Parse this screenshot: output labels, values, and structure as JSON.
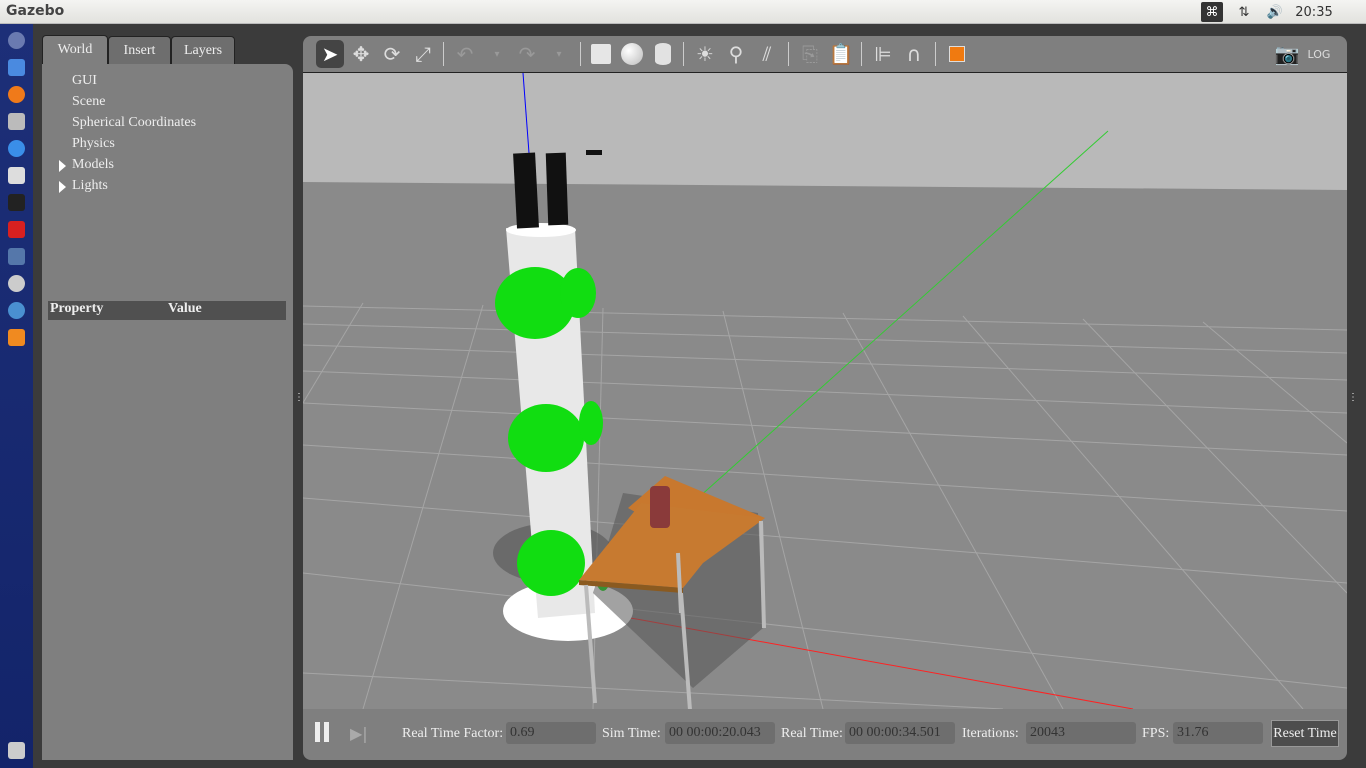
{
  "topbar": {
    "title": "Gazebo",
    "time": "20:35"
  },
  "left": {
    "tabs": [
      "World",
      "Insert",
      "Layers"
    ],
    "tree": [
      "GUI",
      "Scene",
      "Spherical Coordinates",
      "Physics",
      "Models",
      "Lights"
    ],
    "property_header": "Property",
    "value_header": "Value"
  },
  "bottom": {
    "rtf_label": "Real Time Factor:",
    "rtf": "0.69",
    "sim_label": "Sim Time:",
    "sim": "00 00:00:20.043",
    "real_label": "Real Time:",
    "real": "00 00:00:34.501",
    "iter_label": "Iterations:",
    "iter": "20043",
    "fps_label": "FPS:",
    "fps": "31.76",
    "reset": "Reset Time"
  },
  "colors": {
    "launcher": "#1d2f78",
    "panel": "#7f7f7f",
    "sky": "#b9b9b9",
    "ground": "#8a8a8a",
    "sphere": "#00dd00"
  }
}
